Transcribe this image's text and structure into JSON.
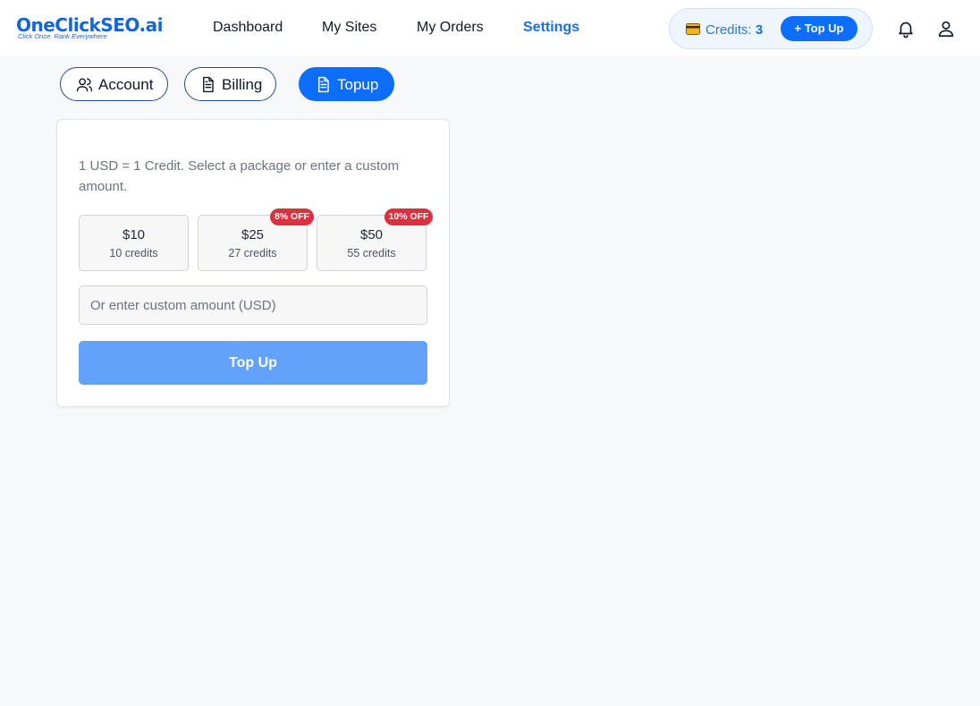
{
  "brand": {
    "name": "OneClickSEO.ai",
    "tagline": "Click Once. Rank Everywhere",
    "accent_color": "#0d6efd"
  },
  "nav": {
    "items": [
      {
        "label": "Dashboard",
        "active": false
      },
      {
        "label": "My Sites",
        "active": false
      },
      {
        "label": "My Orders",
        "active": false
      },
      {
        "label": "Settings",
        "active": true
      }
    ]
  },
  "credits": {
    "label": "Credits:",
    "value": "3",
    "icon": "wallet-icon",
    "topup_label": "+ Top Up"
  },
  "header_icons": [
    "bell-icon",
    "user-icon"
  ],
  "tabs": [
    {
      "label": "Account",
      "icon": "users-icon",
      "active": false
    },
    {
      "label": "Billing",
      "icon": "document-icon",
      "active": false
    },
    {
      "label": "Topup",
      "icon": "document-icon",
      "active": true
    }
  ],
  "topup": {
    "description": "1 USD = 1 Credit. Select a package or enter a custom amount.",
    "packages": [
      {
        "price": "$10",
        "credits": "10 credits",
        "badge": ""
      },
      {
        "price": "$25",
        "credits": "27 credits",
        "badge": "8% OFF"
      },
      {
        "price": "$50",
        "credits": "55 credits",
        "badge": "10% OFF"
      }
    ],
    "custom_placeholder": "Or enter custom amount (USD)",
    "custom_value": "",
    "submit_label": "Top Up"
  }
}
